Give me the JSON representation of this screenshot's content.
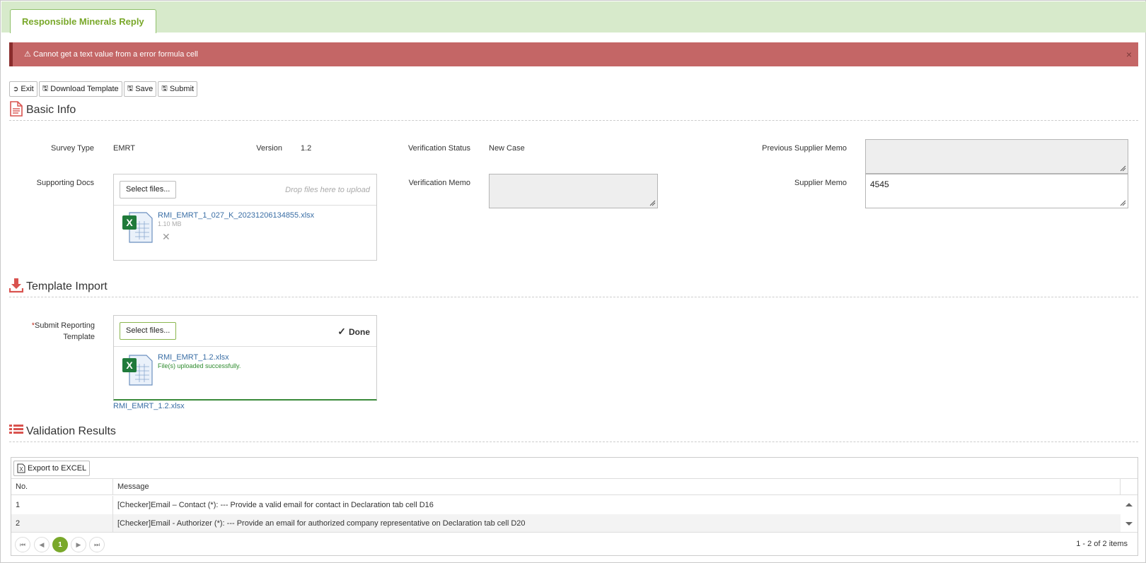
{
  "tab": {
    "label": "Responsible Minerals Reply"
  },
  "alert": {
    "message": "Cannot get a text value from a error formula cell",
    "close_label": "×"
  },
  "toolbar": {
    "exit_label": "Exit",
    "download_label": "Download Template",
    "save_label": "Save",
    "submit_label": "Submit"
  },
  "basic_info": {
    "title": "Basic Info",
    "survey_type_label": "Survey Type",
    "survey_type_value": "EMRT",
    "version_label": "Version",
    "version_value": "1.2",
    "verification_status_label": "Verification Status",
    "verification_status_value": "New Case",
    "previous_supplier_memo_label": "Previous Supplier Memo",
    "previous_supplier_memo_value": "",
    "supporting_docs_label": "Supporting Docs",
    "select_files_label": "Select files...",
    "drop_hint": "Drop files here to upload",
    "file_name": "RMI_EMRT_1_027_K_20231206134855.xlsx",
    "file_size": "1.10 MB",
    "remove_label": "✕",
    "verification_memo_label": "Verification Memo",
    "verification_memo_value": "",
    "supplier_memo_label": "Supplier Memo",
    "supplier_memo_value": "4545"
  },
  "template_import": {
    "title": "Template Import",
    "required_mark": "*",
    "submit_label_line1": "Submit Reporting",
    "submit_label_line2": "Template",
    "select_files_label": "Select files...",
    "done_label": "Done",
    "file_name": "RMI_EMRT_1.2.xlsx",
    "upload_status": "File(s) uploaded successfully.",
    "uploaded_link": "RMI_EMRT_1.2.xlsx"
  },
  "validation": {
    "title": "Validation Results",
    "export_label": "Export to EXCEL",
    "columns": [
      "No.",
      "Message"
    ],
    "rows": [
      {
        "no": "1",
        "message": "[Checker]Email – Contact (*): --- Provide a valid email for contact in Declaration tab cell D16"
      },
      {
        "no": "2",
        "message": "[Checker]Email - Authorizer (*): --- Provide an email for authorized company representative on Declaration tab cell D20"
      }
    ],
    "current_page": "1",
    "page_info": "1 - 2 of 2 items"
  },
  "colors": {
    "accent": "#79a82a",
    "alert": "#c46666",
    "section_icon": "#d9534f"
  }
}
